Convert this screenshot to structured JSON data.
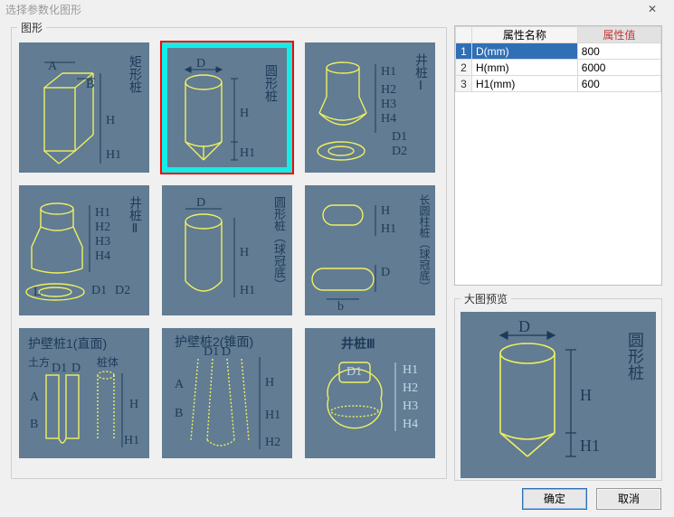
{
  "window": {
    "title": "选择参数化图形",
    "close_glyph": "✕"
  },
  "groups": {
    "shapes": "图形",
    "preview": "大图预览"
  },
  "shapes": [
    {
      "id": "rect-pile",
      "title": "矩形桩",
      "labels": {
        "A": "A",
        "B": "B",
        "H": "H",
        "H1": "H1"
      }
    },
    {
      "id": "cyl-pile",
      "title": "圆形桩",
      "labels": {
        "D": "D",
        "H": "H",
        "H1": "H1"
      }
    },
    {
      "id": "well-1",
      "title": "井桩Ⅰ",
      "labels": {
        "H1": "H1",
        "H2": "H2",
        "H3": "H3",
        "H4": "H4",
        "D1": "D1",
        "D2": "D2"
      }
    },
    {
      "id": "well-2",
      "title": "井桩Ⅱ",
      "labels": {
        "H1": "H1",
        "H2": "H2",
        "H3": "H3",
        "H4": "H4",
        "D1": "D1",
        "D2": "D2",
        "L": "L"
      }
    },
    {
      "id": "cyl-cap",
      "title": "圆形桩（球冠底）",
      "labels": {
        "D": "D",
        "H": "H",
        "H1": "H1"
      }
    },
    {
      "id": "long-cyl-cap",
      "title": "长圆柱桩（球冠底）",
      "labels": {
        "H": "H",
        "H1": "H1",
        "D": "D",
        "b": "b"
      }
    },
    {
      "id": "wall-1",
      "title": "护壁桩1(直面)",
      "sub1": "土方",
      "sub2": "桩体",
      "labels": {
        "A": "A",
        "B": "B",
        "D1": "D1",
        "D": "D",
        "H": "H",
        "H1": "H1"
      }
    },
    {
      "id": "wall-2",
      "title": "护壁桩2(锥面)",
      "labels": {
        "A": "A",
        "B": "B",
        "D1": "D1",
        "D": "D",
        "H": "H",
        "H1": "H1",
        "H2": "H2"
      }
    },
    {
      "id": "well-3",
      "title": "井桩Ⅲ",
      "labels": {
        "D1": "D1",
        "H1": "H1",
        "H2": "H2",
        "H3": "H3",
        "H4": "H4"
      }
    }
  ],
  "selected_shape": 1,
  "prop_header": {
    "name": "属性名称",
    "value": "属性值"
  },
  "properties": [
    {
      "name": "D(mm)",
      "value": "800"
    },
    {
      "name": "H(mm)",
      "value": "6000"
    },
    {
      "name": "H1(mm)",
      "value": "600"
    }
  ],
  "selected_prop": 0,
  "preview_shape": {
    "title": "圆形桩",
    "labels": {
      "D": "D",
      "H": "H",
      "H1": "H1"
    }
  },
  "buttons": {
    "ok": "确定",
    "cancel": "取消"
  }
}
